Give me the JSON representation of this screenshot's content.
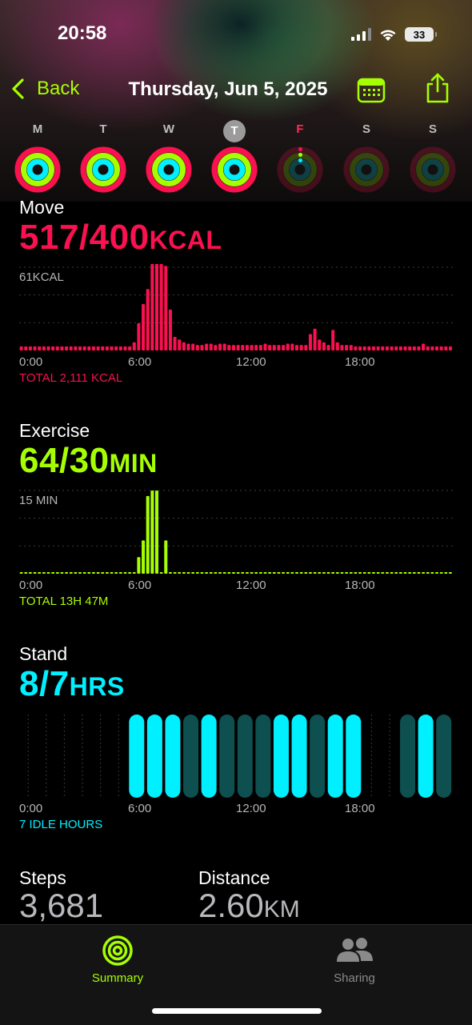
{
  "status_bar": {
    "time": "20:58",
    "battery": "33"
  },
  "nav": {
    "back_label": "Back",
    "title": "Thursday, Jun 5, 2025"
  },
  "week": {
    "days": [
      {
        "letter": "M",
        "state": "past",
        "move": 1.0,
        "exercise": 1.0,
        "stand": 1.0
      },
      {
        "letter": "T",
        "state": "past",
        "move": 1.0,
        "exercise": 1.0,
        "stand": 1.0
      },
      {
        "letter": "W",
        "state": "past",
        "move": 1.0,
        "exercise": 1.0,
        "stand": 1.0
      },
      {
        "letter": "T",
        "state": "today",
        "move": 1.0,
        "exercise": 1.0,
        "stand": 1.0
      },
      {
        "letter": "F",
        "state": "future",
        "move": 0,
        "exercise": 0,
        "stand": 0
      },
      {
        "letter": "S",
        "state": "future",
        "move": 0,
        "exercise": 0,
        "stand": 0
      },
      {
        "letter": "S",
        "state": "future",
        "move": 0,
        "exercise": 0,
        "stand": 0
      }
    ]
  },
  "colors": {
    "move": "#fa114f",
    "exercise": "#a6ff00",
    "stand": "#00f0ff",
    "accent": "#a6ff00"
  },
  "move": {
    "title": "Move",
    "value": "517/400",
    "unit": "KCAL",
    "ref_label": "61KCAL",
    "total": "TOTAL 2,111 KCAL",
    "axis": [
      "0:00",
      "6:00",
      "12:00",
      "18:00"
    ]
  },
  "exercise": {
    "title": "Exercise",
    "value": "64/30",
    "unit": "MIN",
    "ref_label": "15 MIN",
    "total": "TOTAL 13H 47M",
    "axis": [
      "0:00",
      "6:00",
      "12:00",
      "18:00"
    ]
  },
  "stand": {
    "title": "Stand",
    "value": "8/7",
    "unit": "HRS",
    "total": "7 IDLE HOURS",
    "axis": [
      "0:00",
      "6:00",
      "12:00",
      "18:00"
    ]
  },
  "stats": {
    "steps_label": "Steps",
    "steps_value": "3,681",
    "distance_label": "Distance",
    "distance_value": "2.60",
    "distance_unit": "KM"
  },
  "tabs": {
    "summary": "Summary",
    "sharing": "Sharing"
  },
  "chart_data": [
    {
      "type": "bar",
      "title": "Move",
      "x_unit": "hour",
      "y_unit": "kcal",
      "ref_value": 61,
      "xlim": [
        0,
        24
      ],
      "bins_per_hour": 4,
      "values": [
        3,
        3,
        3,
        3,
        3,
        3,
        3,
        3,
        3,
        3,
        3,
        3,
        3,
        3,
        3,
        3,
        3,
        3,
        3,
        3,
        3,
        3,
        3,
        3,
        3,
        6,
        20,
        34,
        45,
        70,
        80,
        68,
        62,
        30,
        10,
        8,
        6,
        5,
        5,
        4,
        4,
        5,
        5,
        4,
        5,
        5,
        4,
        4,
        4,
        4,
        4,
        4,
        4,
        4,
        5,
        4,
        4,
        4,
        4,
        5,
        5,
        4,
        4,
        4,
        12,
        16,
        8,
        6,
        4,
        15,
        6,
        4,
        4,
        4,
        3,
        3,
        3,
        3,
        3,
        3,
        3,
        3,
        3,
        3,
        3,
        3,
        3,
        3,
        3,
        5,
        3,
        3,
        3,
        3,
        3,
        3
      ]
    },
    {
      "type": "bar",
      "title": "Exercise",
      "x_unit": "hour",
      "y_unit": "min",
      "ref_value": 15,
      "xlim": [
        0,
        24
      ],
      "bins_per_hour": 4,
      "values": [
        0.2,
        0.2,
        0.2,
        0.2,
        0.2,
        0.2,
        0.2,
        0.2,
        0.2,
        0.2,
        0.2,
        0.2,
        0.2,
        0.2,
        0.2,
        0.2,
        0.2,
        0.2,
        0.2,
        0.2,
        0.2,
        0.2,
        0.2,
        0.2,
        0.2,
        0.2,
        3,
        6,
        14,
        15,
        15,
        0.2,
        6,
        0.2,
        0.2,
        0.2,
        0.2,
        0.2,
        0.2,
        0.2,
        0.2,
        0.2,
        0.2,
        0.2,
        0.2,
        0.2,
        0.2,
        0.2,
        0.2,
        0.2,
        0.2,
        0.2,
        0.2,
        0.2,
        0.2,
        0.2,
        0.2,
        0.2,
        0.2,
        0.2,
        0.2,
        0.2,
        0.2,
        0.2,
        0.2,
        0.2,
        0.2,
        0.2,
        0.2,
        0.2,
        0.2,
        0.2,
        0.2,
        0.2,
        0.2,
        0.2,
        0.2,
        0.2,
        0.2,
        0.2,
        0.2,
        0.2,
        0.2,
        0.2,
        0.2,
        0.2,
        0.2,
        0.2,
        0.2,
        0.2,
        0.2,
        0.2,
        0.2,
        0.2,
        0.2,
        0.2
      ]
    },
    {
      "type": "bar",
      "title": "Stand",
      "x_unit": "hour",
      "xlim": [
        0,
        24
      ],
      "stood_hours": [
        6,
        7,
        8,
        10,
        14,
        15,
        17,
        18,
        22
      ],
      "active_hours": [
        6,
        7,
        8,
        9,
        10,
        11,
        12,
        13,
        14,
        15,
        16,
        17,
        18,
        21,
        22,
        23
      ]
    }
  ]
}
